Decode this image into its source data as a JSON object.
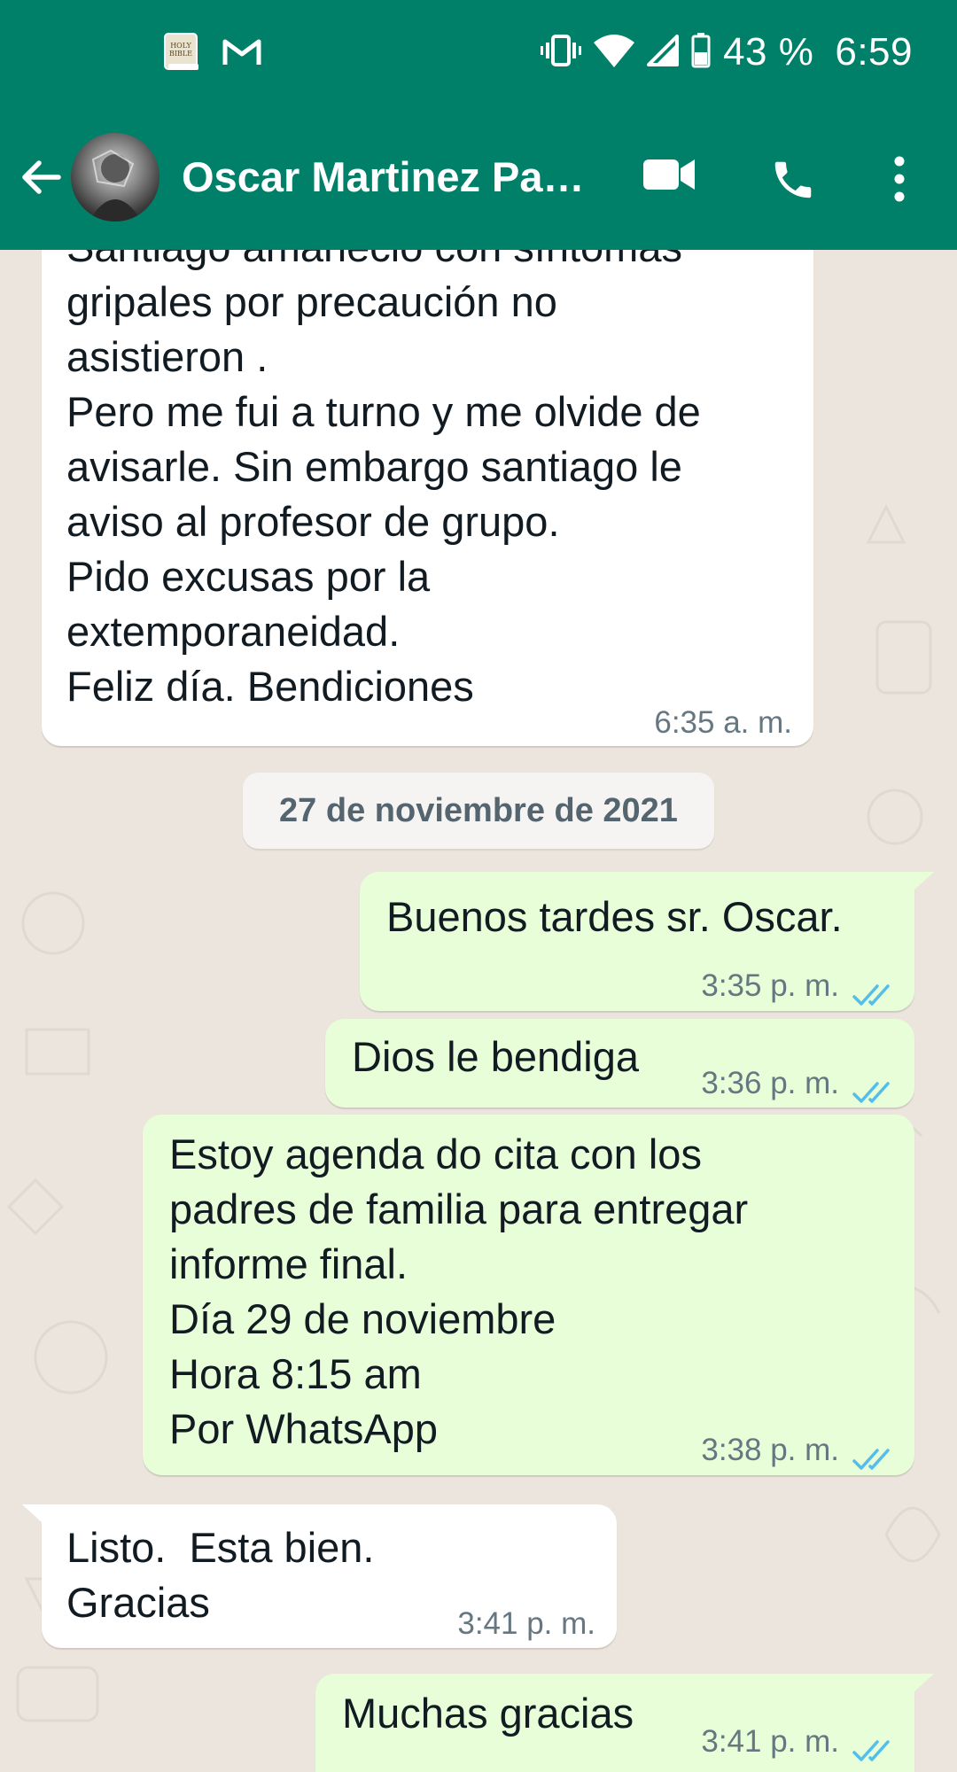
{
  "status_bar": {
    "battery_text": "43 %",
    "clock": "6:59",
    "notification_icons": [
      "holy-bible-app-icon",
      "gmail-icon"
    ],
    "system_icons": [
      "vibrate-icon",
      "wifi-icon",
      "cell-signal-icon",
      "battery-icon"
    ]
  },
  "app_bar": {
    "contact_name": "Oscar Martinez Pa…",
    "icons": [
      "back-arrow-icon",
      "video-call-icon",
      "voice-call-icon",
      "more-options-icon"
    ]
  },
  "chat": {
    "messages": [
      {
        "direction": "incoming",
        "text": "Santiago amaneció con síntomas\ngripales por precaución no\nasistieron .\nPero me fui a turno y me olvide de\navisarle. Sin embargo santiago le\naviso al profesor de grupo.\nPido excusas por la\nextemporaneidad.\nFeliz día. Bendiciones",
        "time": "6:35 a. m."
      },
      {
        "direction": "date",
        "text": "27 de noviembre de 2021"
      },
      {
        "direction": "outgoing",
        "text": "Buenos tardes sr. Oscar.",
        "time": "3:35 p. m.",
        "status": "read"
      },
      {
        "direction": "outgoing",
        "text": "Dios le bendiga",
        "time": "3:36 p. m.",
        "status": "read"
      },
      {
        "direction": "outgoing",
        "text": "Estoy agenda do cita con los\npadres de familia para entregar\ninforme final.\nDía 29 de noviembre\nHora 8:15 am\nPor WhatsApp",
        "time": "3:38 p. m.",
        "status": "read"
      },
      {
        "direction": "incoming",
        "text": "Listo.  Esta bien.\nGracias",
        "time": "3:41 p. m."
      },
      {
        "direction": "outgoing",
        "text": "Muchas gracias",
        "time": "3:41 p. m.",
        "status": "read"
      }
    ]
  },
  "colors": {
    "header_green": "#008069",
    "outgoing_bubble": "#e7fed8",
    "incoming_bubble": "#ffffff",
    "chat_background": "#ece5dd",
    "read_ticks": "#53bdeb"
  }
}
